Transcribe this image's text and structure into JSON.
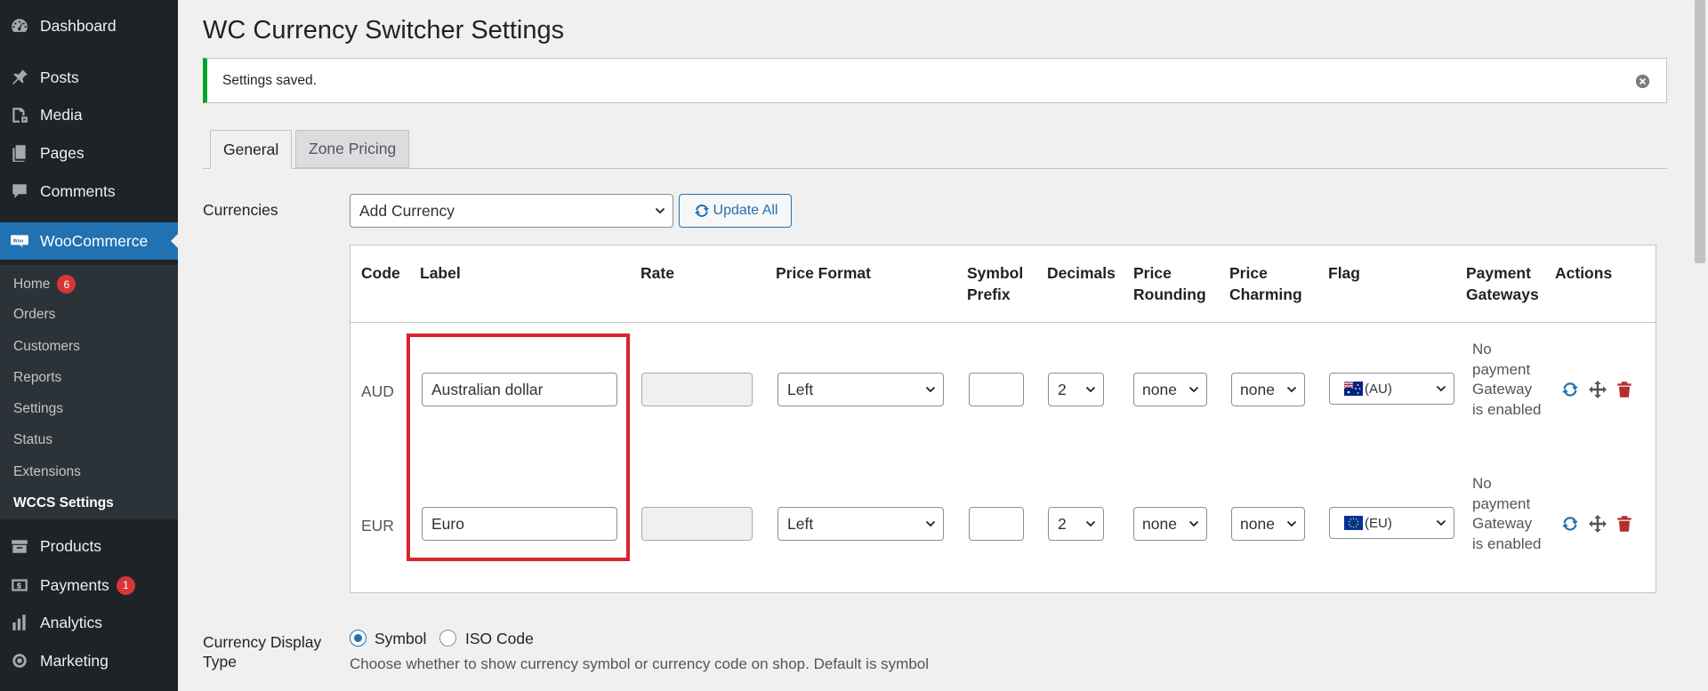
{
  "sidebar": {
    "items": [
      {
        "label": "Dashboard",
        "icon": "dashboard-icon"
      },
      {
        "label": "Posts",
        "icon": "pin-icon"
      },
      {
        "label": "Media",
        "icon": "media-icon"
      },
      {
        "label": "Pages",
        "icon": "pages-icon"
      },
      {
        "label": "Comments",
        "icon": "comment-icon"
      },
      {
        "label": "WooCommerce",
        "icon": "woo-icon"
      },
      {
        "label": "Products",
        "icon": "archive-icon"
      },
      {
        "label": "Payments",
        "icon": "dollar-icon",
        "badge": "1"
      },
      {
        "label": "Analytics",
        "icon": "bar-chart-icon"
      },
      {
        "label": "Marketing",
        "icon": "megaphone-icon"
      }
    ],
    "submenu": [
      {
        "label": "Home",
        "badge": "6"
      },
      {
        "label": "Orders"
      },
      {
        "label": "Customers"
      },
      {
        "label": "Reports"
      },
      {
        "label": "Settings"
      },
      {
        "label": "Status"
      },
      {
        "label": "Extensions"
      },
      {
        "label": "WCCS Settings"
      }
    ]
  },
  "page": {
    "title": "WC Currency Switcher Settings",
    "notice": "Settings saved.",
    "tabs": [
      {
        "label": "General"
      },
      {
        "label": "Zone Pricing"
      }
    ]
  },
  "currencies": {
    "label": "Currencies",
    "add_select": "Add Currency",
    "update_all": "Update All",
    "headers": {
      "code": "Code",
      "label": "Label",
      "rate": "Rate",
      "price_format": "Price Format",
      "symbol_prefix": "Symbol Prefix",
      "decimals": "Decimals",
      "price_rounding": "Price Rounding",
      "price_charming": "Price Charming",
      "flag": "Flag",
      "payment_gateways": "Payment Gateways",
      "actions": "Actions"
    },
    "rows": [
      {
        "code": "AUD",
        "label": "Australian dollar",
        "rate": "",
        "price_format": "Left",
        "symbol_prefix": "",
        "decimals": "2",
        "rounding": "none",
        "charming": "none",
        "flag": "(AU)",
        "gateways": "No payment Gateway is enabled"
      },
      {
        "code": "EUR",
        "label": "Euro",
        "rate": "",
        "price_format": "Left",
        "symbol_prefix": "",
        "decimals": "2",
        "rounding": "none",
        "charming": "none",
        "flag": "(EU)",
        "gateways": "No payment Gateway is enabled"
      }
    ]
  },
  "display_type": {
    "label": "Currency Display Type",
    "options": [
      {
        "label": "Symbol",
        "checked": true
      },
      {
        "label": "ISO Code",
        "checked": false
      }
    ],
    "description": "Choose whether to show currency symbol or currency code on shop. Default is symbol"
  },
  "colors": {
    "sidebar_bg": "#1d2327",
    "accent": "#2271b1",
    "success": "#00a32a",
    "highlight": "#d9242e",
    "delete": "#b32d2e"
  }
}
